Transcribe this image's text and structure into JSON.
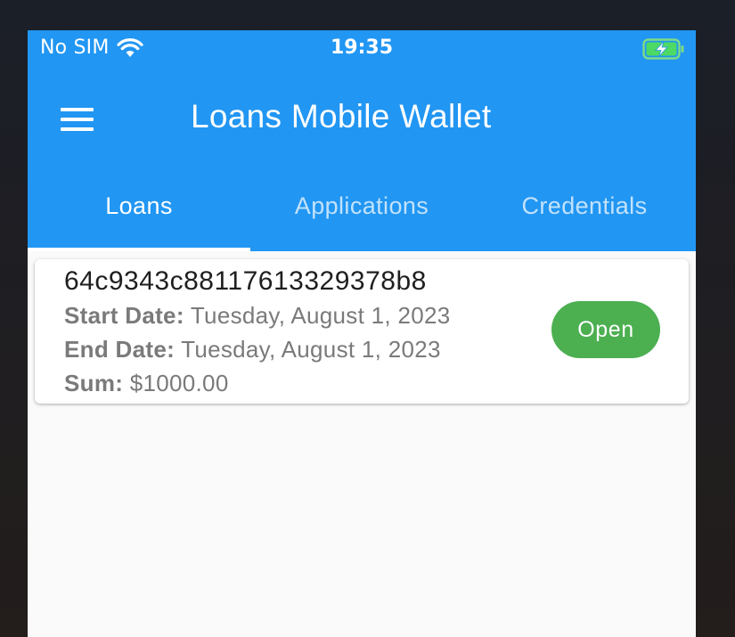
{
  "status_bar": {
    "carrier": "No SIM",
    "time": "19:35",
    "wifi_icon": "wifi-icon",
    "battery_icon": "battery-charging-icon"
  },
  "app_bar": {
    "title": "Loans Mobile Wallet",
    "menu_icon": "hamburger-menu-icon",
    "color": "#2196f3"
  },
  "tabs": [
    {
      "label": "Loans",
      "active": true
    },
    {
      "label": "Applications",
      "active": false
    },
    {
      "label": "Credentials",
      "active": false
    }
  ],
  "loans": [
    {
      "id": "64c9343c88117613329378b8",
      "start_label": "Start Date:",
      "start_date": "Tuesday, August 1, 2023",
      "end_label": "End Date:",
      "end_date": "Tuesday, August 1, 2023",
      "sum_label": "Sum:",
      "sum": "$1000.00",
      "status": "Open",
      "status_color": "#4caf50"
    }
  ]
}
